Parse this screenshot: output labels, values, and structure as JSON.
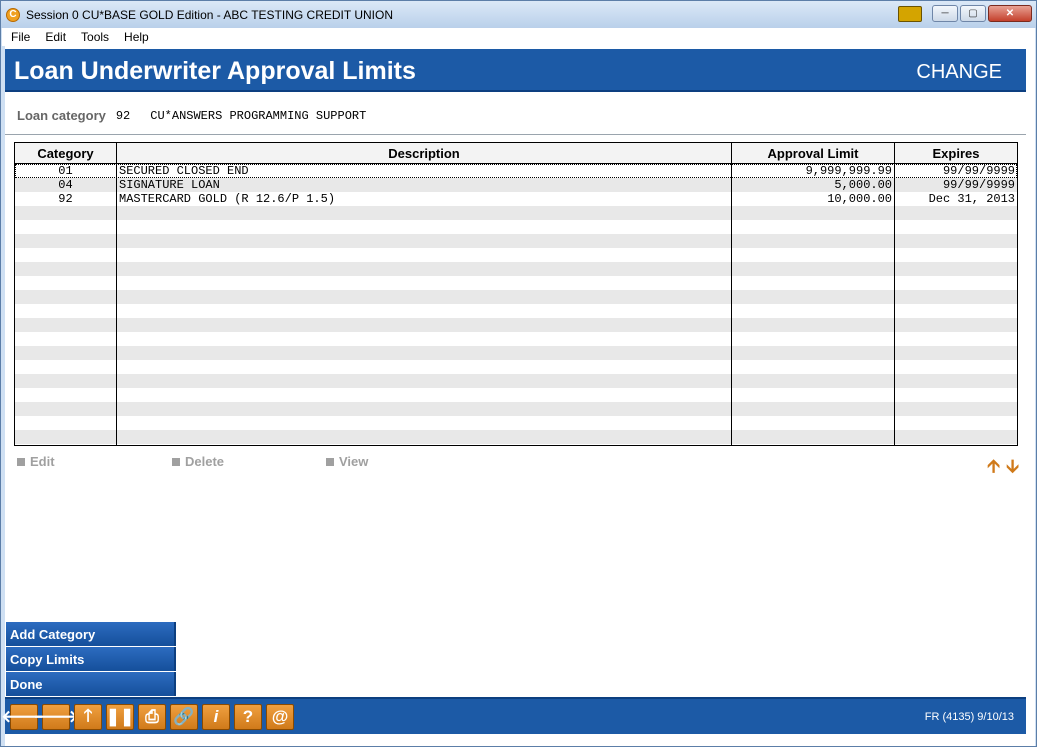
{
  "window": {
    "title": "Session 0 CU*BASE GOLD Edition - ABC TESTING CREDIT UNION",
    "app_icon": "cu-icon",
    "controls": [
      "minimize",
      "maximize",
      "close"
    ]
  },
  "menu": [
    "File",
    "Edit",
    "Tools",
    "Help"
  ],
  "header": {
    "title": "Loan Underwriter Approval Limits",
    "mode": "CHANGE"
  },
  "loan_category": {
    "label": "Loan category",
    "code": "92",
    "name": "CU*ANSWERS PROGRAMMING SUPPORT"
  },
  "table": {
    "columns": [
      "Category",
      "Description",
      "Approval Limit",
      "Expires"
    ],
    "rows": [
      [
        "01",
        "SECURED CLOSED END",
        "9,999,999.99",
        "99/99/9999"
      ],
      [
        "04",
        "SIGNATURE LOAN",
        "5,000.00",
        "99/99/9999"
      ],
      [
        "92",
        "MASTERCARD GOLD (R 12.6/P 1.5)",
        "10,000.00",
        "Dec 31, 2013"
      ]
    ]
  },
  "row_actions": [
    "Edit",
    "Delete",
    "View"
  ],
  "side_buttons": [
    "Add Category",
    "Copy Limits",
    "Done"
  ],
  "footer": {
    "tools": [
      "back-arrow-icon",
      "forward-arrow-icon",
      "up-arrow-icon",
      "pause-icon",
      "print-icon",
      "link-icon",
      "info-icon",
      "help-icon",
      "email-icon"
    ],
    "code": "FR (4135) 9/10/13"
  },
  "colors": {
    "header_blue": "#1c5aa6",
    "toolbar_orange": "#d07a1a",
    "disabled_gray": "#a0a0a0"
  }
}
